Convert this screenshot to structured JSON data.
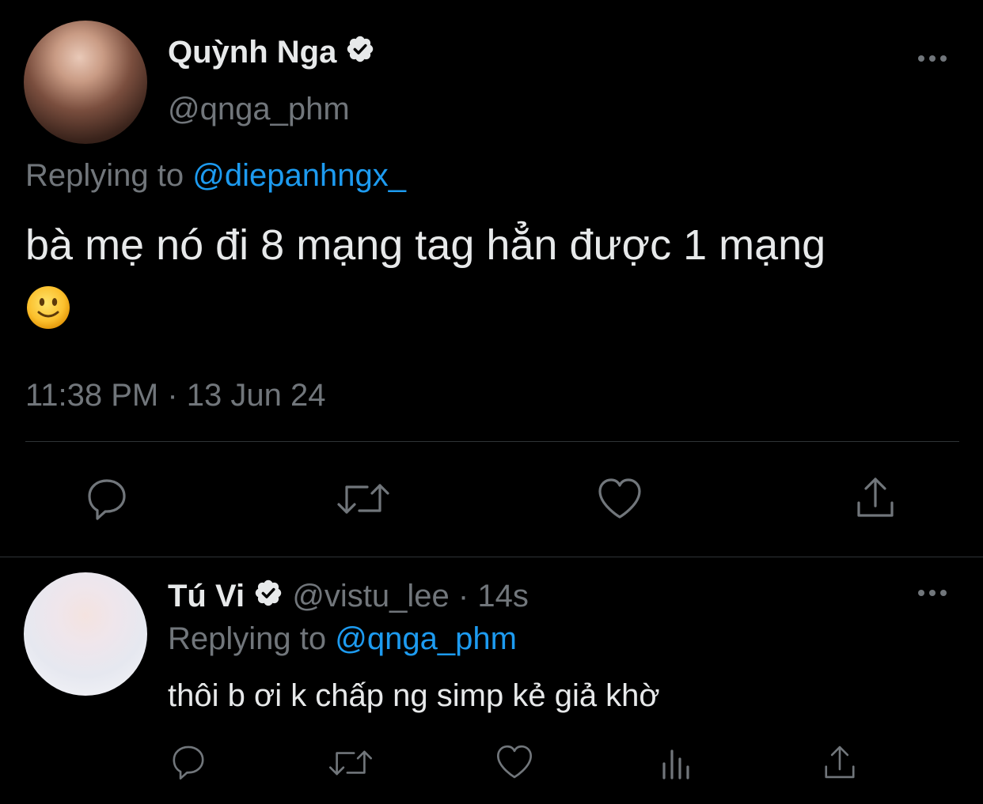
{
  "tweet": {
    "display_name": "Quỳnh Nga",
    "handle": "@qnga_phm",
    "replying_label": "Replying to ",
    "replying_to": "@diepanhngx_",
    "text_line1": "bà mẹ nó đi 8 mạng tag hẳn được 1 mạng",
    "text_emoji": "🙂",
    "timestamp": "11:38 PM · 13 Jun 24"
  },
  "reply": {
    "display_name": "Tú Vi",
    "handle": "@vistu_lee",
    "separator": " · ",
    "age": "14s",
    "replying_label": "Replying to ",
    "replying_to": "@qnga_phm",
    "text": "thôi b ơi k chấp ng simp kẻ giả khờ"
  },
  "icons": {
    "actions": [
      "reply-icon",
      "retweet-icon",
      "like-icon",
      "share-icon"
    ],
    "reply_actions": [
      "reply-icon",
      "retweet-icon",
      "like-icon",
      "analytics-icon",
      "share-icon"
    ]
  },
  "colors": {
    "background": "#000000",
    "text": "#e7e9ea",
    "muted": "#71767b",
    "link": "#1d9bf0"
  }
}
